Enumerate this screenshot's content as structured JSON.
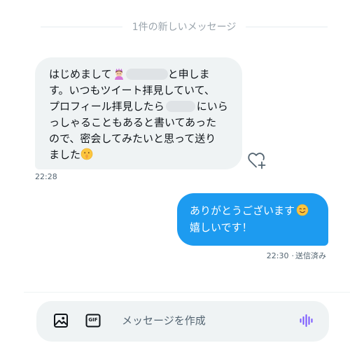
{
  "divider_label": "1件の新しいメッセージ",
  "received": {
    "lines": [
      {
        "before": "はじめまして",
        "after": "と申しま"
      },
      {
        "text": "す。いつもツイート拝見していて、"
      },
      {
        "before": "プロフィール拝見したら",
        "after": "にいら"
      },
      {
        "text": "っしゃることもあると書いてあった"
      },
      {
        "text": "ので、密会してみたいと思って送り"
      },
      {
        "text": "ました"
      }
    ],
    "time": "22:28"
  },
  "sent": {
    "lines": [
      "ありがとうございます",
      "嬉しいです！"
    ],
    "time": "22:30",
    "status": "送信済み"
  },
  "composer": {
    "placeholder": "メッセージを作成",
    "gif_label": "GIF"
  },
  "colors": {
    "accent": "#1d9bf0",
    "received_bubble": "#eff3f4",
    "muted_text": "#536471"
  },
  "icons": [
    "heart-add-icon",
    "image-icon",
    "gif-icon",
    "voice-icon",
    "princess-emoji",
    "shushing-face-emoji",
    "smiling-face-emoji"
  ]
}
